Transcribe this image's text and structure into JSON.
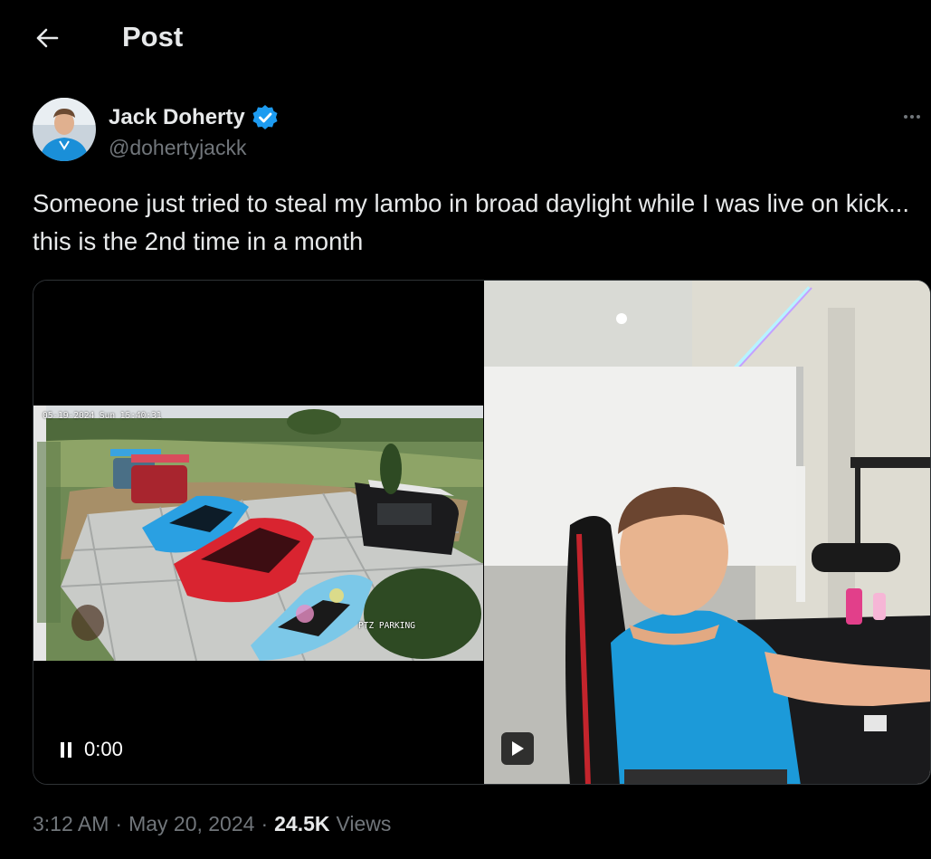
{
  "header": {
    "title": "Post",
    "back_icon": "arrow-left-icon"
  },
  "author": {
    "display_name": "Jack Doherty",
    "handle": "@dohertyjackk",
    "verified_icon": "verified-badge-icon",
    "verified_color": "#1d9bf0",
    "more_icon": "more-horizontal-icon"
  },
  "post": {
    "text": "Someone just tried to steal my lambo in broad daylight while I was live on kick... this is the 2nd time in a month"
  },
  "media": {
    "left_video": {
      "timestamp_overlay": "05-19-2024 Sun 15:40:31",
      "camera_label": "PTZ PARKING",
      "pause_icon": "pause-icon",
      "time": "0:00"
    },
    "right_video": {
      "play_icon": "play-icon"
    }
  },
  "meta": {
    "time": "3:12 AM",
    "date": "May 20, 2024",
    "views_count": "24.5K",
    "views_label": "Views",
    "separator": "·"
  },
  "colors": {
    "background": "#000000",
    "text_primary": "#e7e9ea",
    "text_secondary": "#71767b",
    "border": "#2f3336"
  }
}
